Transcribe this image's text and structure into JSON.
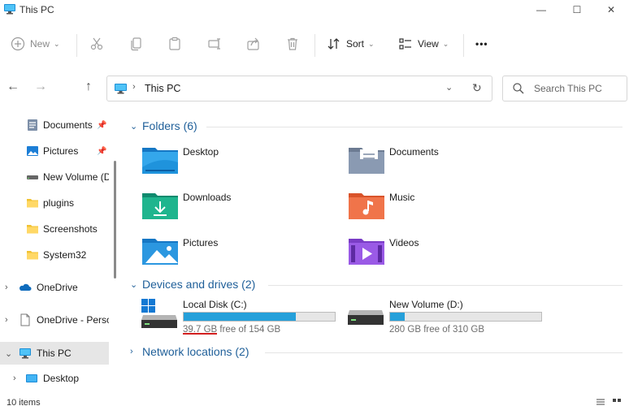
{
  "window": {
    "title": "This PC",
    "controls": {
      "minimize": "—",
      "maximize": "☐",
      "close": "✕"
    }
  },
  "toolbar": {
    "new_label": "New",
    "sort_label": "Sort",
    "view_label": "View",
    "more_label": "•••"
  },
  "nav": {
    "back": "←",
    "forward": "→",
    "up": "↑",
    "address": "This PC",
    "search_placeholder": "Search This PC"
  },
  "sidebar": {
    "items": [
      {
        "label": "Documents",
        "icon": "documents-icon",
        "pinned": true
      },
      {
        "label": "Pictures",
        "icon": "pictures-icon",
        "pinned": true
      },
      {
        "label": "New Volume (D:)",
        "icon": "drive-icon",
        "pinned": false
      },
      {
        "label": "plugins",
        "icon": "folder-icon",
        "pinned": false
      },
      {
        "label": "Screenshots",
        "icon": "folder-icon",
        "pinned": false
      },
      {
        "label": "System32",
        "icon": "folder-icon",
        "pinned": false
      },
      {
        "label": "OneDrive",
        "icon": "onedrive-icon",
        "expandable": true
      },
      {
        "label": "OneDrive - Personal",
        "icon": "file-icon",
        "expandable": true
      },
      {
        "label": "This PC",
        "icon": "pc-icon",
        "expandable": true,
        "expanded": true,
        "selected": true
      },
      {
        "label": "Desktop",
        "icon": "desktop-icon",
        "expandable": true
      }
    ]
  },
  "content": {
    "folders_header": "Folders (6)",
    "folders": [
      {
        "label": "Desktop",
        "icon": "desktop-folder-icon"
      },
      {
        "label": "Documents",
        "icon": "documents-folder-icon"
      },
      {
        "label": "Downloads",
        "icon": "downloads-folder-icon"
      },
      {
        "label": "Music",
        "icon": "music-folder-icon"
      },
      {
        "label": "Pictures",
        "icon": "pictures-folder-icon"
      },
      {
        "label": "Videos",
        "icon": "videos-folder-icon"
      }
    ],
    "drives_header": "Devices and drives (2)",
    "drives": [
      {
        "name": "Local Disk (C:)",
        "free_amount": "39.7 GB",
        "free_rest": " free of 154 GB",
        "used_fraction": 0.742,
        "color": "#26a0da"
      },
      {
        "name": "New Volume (D:)",
        "free_amount": "280 GB",
        "free_rest": " free of 310 GB",
        "used_fraction": 0.097,
        "color": "#26a0da"
      }
    ],
    "network_header": "Network locations (2)"
  },
  "status": {
    "items": "10 items"
  },
  "colors": {
    "accent": "#1f5f99",
    "underline": "#d21f1f"
  }
}
